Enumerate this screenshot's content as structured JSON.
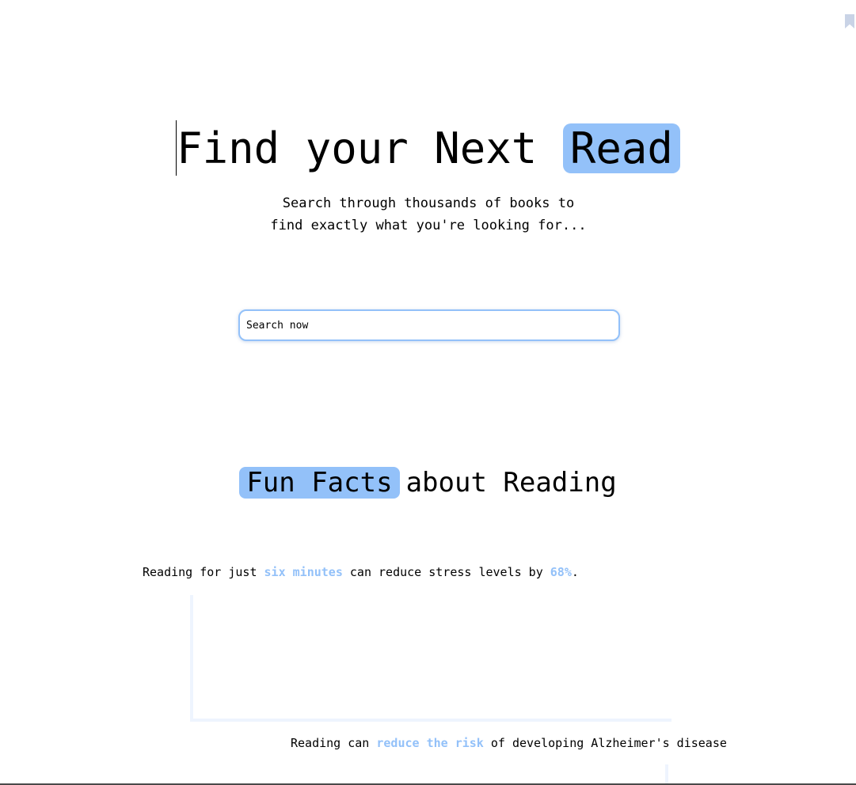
{
  "hero": {
    "title_part1": "Find your Next ",
    "title_highlight": "Read",
    "subtitle": "Search through thousands of books to find exactly what you're looking for..."
  },
  "search": {
    "value": "",
    "placeholder": "Search now"
  },
  "facts_section": {
    "title_highlight": "Fun Facts",
    "title_rest": "about Reading"
  },
  "facts": [
    {
      "before": "Reading for just ",
      "accent1": "six minutes",
      "middle": " can reduce stress levels by ",
      "accent2": "68%",
      "after": "."
    },
    {
      "before": "Reading can ",
      "accent1": "reduce the risk",
      "after": " of developing Alzheimer's disease"
    }
  ],
  "colors": {
    "accent": "#93c1f9",
    "decoration": "#eef4fe",
    "bookmark": "#c9d3e6"
  },
  "icons": {
    "bookmark": "bookmark-icon"
  }
}
